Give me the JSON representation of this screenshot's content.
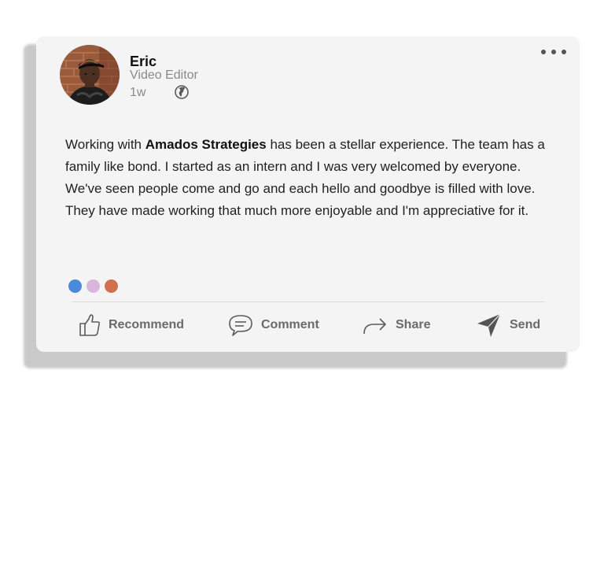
{
  "post": {
    "author": {
      "name": "Eric",
      "role": "Video Editor",
      "age": "1w",
      "visibility_icon": "globe-icon"
    },
    "body": {
      "p1": "Working with ",
      "company": "Amados Strategies",
      "p2": " has been a stellar experience. The team has a family like bond. I started as an intern and I was very welcomed by everyone. We've seen people come and go and each hello and goodbye is filled with love. They have made working that much more enjoyable and I'm appreciative for it."
    },
    "reactions": [
      {
        "icon": "reaction-dot",
        "color": "#4a89dc"
      },
      {
        "icon": "reaction-dot",
        "color": "#dbb6dc"
      },
      {
        "icon": "reaction-dot",
        "color": "#d0704f"
      }
    ]
  },
  "actions": {
    "recommend": {
      "label": "Recommend",
      "icon": "thumbs-up-icon"
    },
    "comment": {
      "label": "Comment",
      "icon": "comment-icon"
    },
    "share": {
      "label": "Share",
      "icon": "share-arrow-icon"
    },
    "send": {
      "label": "Send",
      "icon": "send-icon"
    }
  },
  "colors": {
    "card_background": "#f4f4f4",
    "action_text": "#6a6a6a",
    "muted_text": "#8a8a8a"
  }
}
